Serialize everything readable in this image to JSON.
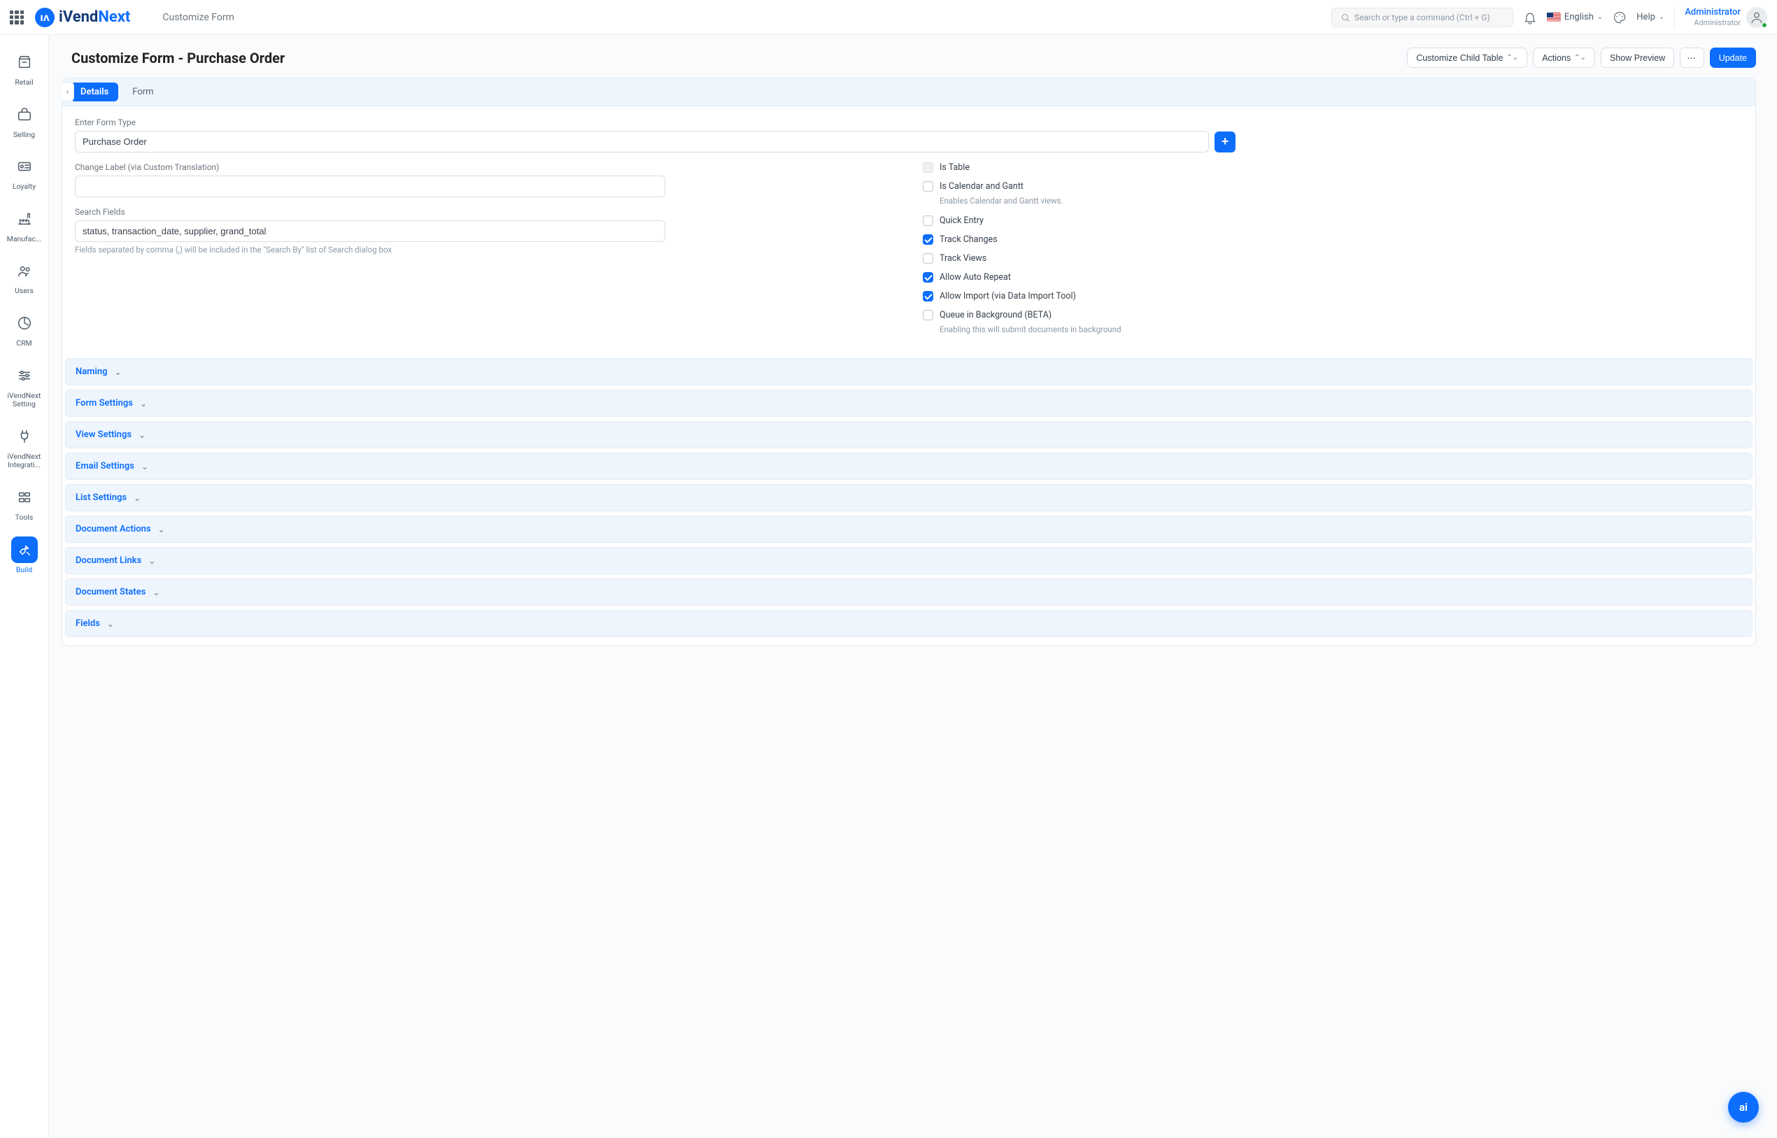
{
  "header": {
    "breadcrumb": "Customize Form",
    "search_placeholder": "Search or type a command (Ctrl + G)",
    "language": "English",
    "help": "Help",
    "user_name": "Administrator",
    "user_role": "Administrator"
  },
  "brand": {
    "prefix": "iVend",
    "suffix": "Next"
  },
  "sidebar": {
    "items": [
      {
        "label": "Retail"
      },
      {
        "label": "Selling"
      },
      {
        "label": "Loyalty"
      },
      {
        "label": "Manufac..."
      },
      {
        "label": "Users"
      },
      {
        "label": "CRM"
      },
      {
        "label": "iVendNext Setting"
      },
      {
        "label": "iVendNext Integrati..."
      },
      {
        "label": "Tools"
      },
      {
        "label": "Build"
      }
    ]
  },
  "page": {
    "title": "Customize Form - Purchase Order",
    "actions": {
      "customize_child": "Customize Child Table",
      "actions": "Actions",
      "show_preview": "Show Preview",
      "update": "Update"
    }
  },
  "tabs": {
    "details": "Details",
    "form": "Form"
  },
  "form": {
    "form_type_label": "Enter Form Type",
    "form_type_value": "Purchase Order",
    "change_label_label": "Change Label (via Custom Translation)",
    "change_label_value": "",
    "search_fields_label": "Search Fields",
    "search_fields_value": "status, transaction_date, supplier, grand_total",
    "search_fields_help": "Fields separated by comma (,) will be included in the \"Search By\" list of Search dialog box",
    "checks": {
      "is_table": {
        "label": "Is Table",
        "checked": false,
        "disabled": true
      },
      "is_calendar": {
        "label": "Is Calendar and Gantt",
        "checked": false,
        "help": "Enables Calendar and Gantt views."
      },
      "quick_entry": {
        "label": "Quick Entry",
        "checked": false
      },
      "track_changes": {
        "label": "Track Changes",
        "checked": true
      },
      "track_views": {
        "label": "Track Views",
        "checked": false
      },
      "allow_auto_repeat": {
        "label": "Allow Auto Repeat",
        "checked": true
      },
      "allow_import": {
        "label": "Allow Import (via Data Import Tool)",
        "checked": true
      },
      "queue_bg": {
        "label": "Queue in Background (BETA)",
        "checked": false,
        "help": "Enabling this will submit documents in background"
      }
    }
  },
  "sections": [
    "Naming",
    "Form Settings",
    "View Settings",
    "Email Settings",
    "List Settings",
    "Document Actions",
    "Document Links",
    "Document States",
    "Fields"
  ],
  "fab": "ai"
}
